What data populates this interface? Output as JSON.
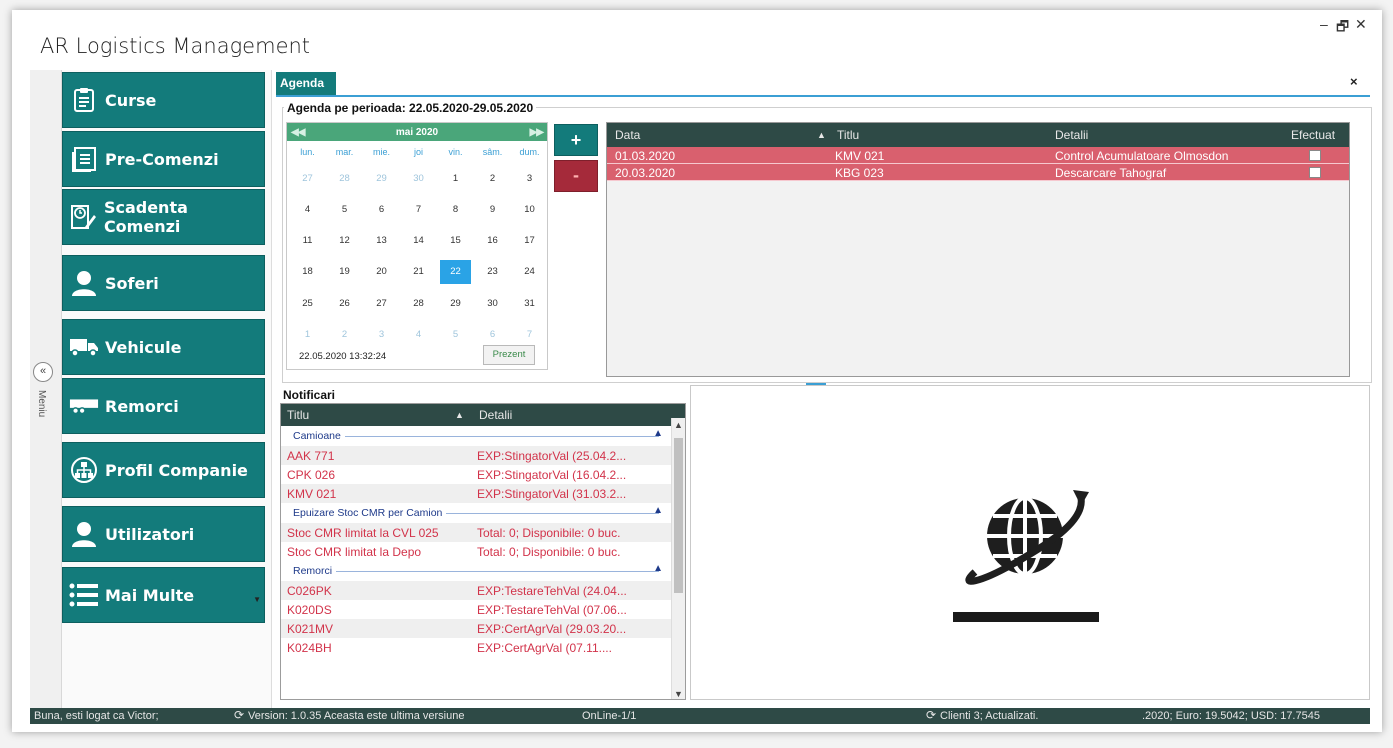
{
  "app": {
    "title": "AR Logistics Management",
    "minimize": "–",
    "restore": "🗗",
    "close": "✕"
  },
  "rail": {
    "collapse": "«",
    "label": "Meniu"
  },
  "nav": [
    {
      "label": "Curse",
      "icon": "clipboard-icon"
    },
    {
      "label": "Pre-Comenzi",
      "icon": "document-list-icon"
    },
    {
      "label": "Scadenta Comenzi",
      "icon": "document-clock-icon"
    },
    {
      "label": "Soferi",
      "icon": "user-icon"
    },
    {
      "label": "Vehicule",
      "icon": "truck-icon"
    },
    {
      "label": "Remorci",
      "icon": "trailer-icon"
    },
    {
      "label": "Profil Companie",
      "icon": "org-chart-icon"
    },
    {
      "label": "Utilizatori",
      "icon": "user-icon"
    },
    {
      "label": "Mai Multe",
      "icon": "menu-list-icon"
    }
  ],
  "tab": {
    "label": "Agenda",
    "close": "×"
  },
  "agenda": {
    "title": "Agenda pe perioada: 22.05.2020-29.05.2020"
  },
  "calendar": {
    "month": "mai 2020",
    "dows": [
      "lun.",
      "mar.",
      "mie.",
      "joi",
      "vin.",
      "sâm.",
      "dum."
    ],
    "days": [
      [
        "27",
        "28",
        "29",
        "30",
        "1",
        "2",
        "3"
      ],
      [
        "4",
        "5",
        "6",
        "7",
        "8",
        "9",
        "10"
      ],
      [
        "11",
        "12",
        "13",
        "14",
        "15",
        "16",
        "17"
      ],
      [
        "18",
        "19",
        "20",
        "21",
        "22",
        "23",
        "24"
      ],
      [
        "25",
        "26",
        "27",
        "28",
        "29",
        "30",
        "31"
      ],
      [
        "1",
        "2",
        "3",
        "4",
        "5",
        "6",
        "7"
      ]
    ],
    "selected": "22",
    "datetime": "22.05.2020 13:32:24",
    "today_button": "Prezent"
  },
  "buttons": {
    "add": "+",
    "delete": "-"
  },
  "events": {
    "columns": {
      "data": "Data",
      "titlu": "Titlu",
      "detalii": "Detalii",
      "efectuat": "Efectuat"
    },
    "rows": [
      {
        "data": "01.03.2020",
        "titlu": "KMV 021",
        "detalii": "Control Acumulatoare Olmosdon"
      },
      {
        "data": "20.03.2020",
        "titlu": "KBG 023",
        "detalii": "Descarcare Tahograf"
      }
    ]
  },
  "notif": {
    "title": "Notificari",
    "columns": {
      "titlu": "Titlu",
      "detalii": "Detalii"
    },
    "groups": [
      {
        "name": "Camioane",
        "rows": [
          {
            "titlu": "AAK 771",
            "detalii": "EXP:StingatorVal (25.04.2..."
          },
          {
            "titlu": "CPK 026",
            "detalii": "EXP:StingatorVal (16.04.2..."
          },
          {
            "titlu": "KMV 021",
            "detalii": "EXP:StingatorVal (31.03.2..."
          }
        ]
      },
      {
        "name": "Epuizare Stoc CMR per Camion",
        "rows": [
          {
            "titlu": "Stoc CMR limitat la CVL 025",
            "detalii": "Total: 0; Disponibile: 0 buc."
          },
          {
            "titlu": "Stoc CMR limitat la Depo",
            "detalii": "Total: 0; Disponibile: 0 buc."
          }
        ]
      },
      {
        "name": "Remorci",
        "rows": [
          {
            "titlu": "C026PK",
            "detalii": "EXP:TestareTehVal (24.04..."
          },
          {
            "titlu": "K020DS",
            "detalii": "EXP:TestareTehVal (07.06..."
          },
          {
            "titlu": "K021MV",
            "detalii": "EXP:CertAgrVal (29.03.20..."
          },
          {
            "titlu": "K024BH",
            "detalii": "EXP:CertAgrVal (07.11...."
          }
        ]
      }
    ]
  },
  "status": {
    "user": "Buna, esti logat ca Victor;",
    "version": "Version: 1.0.35  Aceasta este ultima versiune",
    "online": "OnLine-1/1",
    "clients": "Clienti 3; Actualizati.",
    "rates": ".2020; Euro: 19.5042; USD: 17.7545"
  }
}
